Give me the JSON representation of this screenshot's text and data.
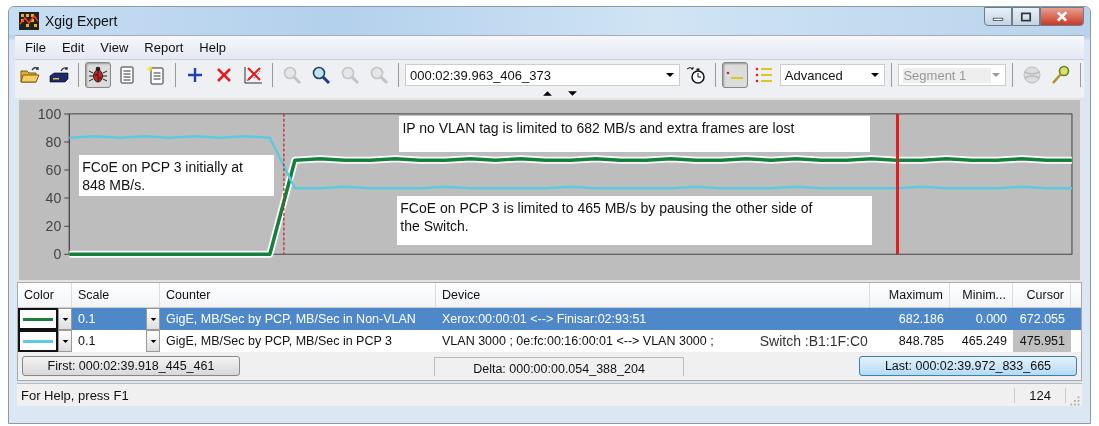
{
  "window": {
    "title": "Xgig Expert"
  },
  "menu": [
    "File",
    "Edit",
    "View",
    "Report",
    "Help"
  ],
  "toolbar": {
    "left_tools": [
      {
        "pressed": false,
        "disabled": false
      },
      {
        "pressed": false,
        "disabled": false
      },
      {
        "pressed": true,
        "disabled": false
      },
      {
        "pressed": false,
        "disabled": false
      },
      {
        "pressed": false,
        "disabled": false
      },
      {
        "pressed": false,
        "disabled": false
      },
      {
        "pressed": false,
        "disabled": false
      },
      {
        "pressed": false,
        "disabled": false
      },
      {
        "pressed": false,
        "disabled": true
      },
      {
        "pressed": false,
        "disabled": false
      },
      {
        "pressed": false,
        "disabled": true
      },
      {
        "pressed": false,
        "disabled": true
      }
    ],
    "time_combo": {
      "value": "000:02:39.963_406_373"
    },
    "mid_tools": [
      {
        "pressed": false,
        "disabled": false
      },
      {
        "pressed": true,
        "disabled": false
      },
      {
        "pressed": false,
        "disabled": false
      }
    ],
    "mode_combo": {
      "value": "Advanced",
      "disabled": false
    },
    "segment_combo": {
      "value": "Segment 1",
      "disabled": true
    },
    "right_tools": [
      {
        "pressed": false,
        "disabled": true
      },
      {
        "pressed": false,
        "disabled": false
      }
    ]
  },
  "chart": {
    "notes": [
      "FCoE on PCP 3 initially at 848 MB/s.",
      "IP no VLAN tag is limited to 682 MB/s and extra frames are lost",
      "FCoE on PCP 3 is limited to 465 MB/s by pausing the other side of the Switch."
    ],
    "chart_data": {
      "type": "line",
      "ylim": [
        0,
        100
      ],
      "yticks": [
        0,
        20,
        40,
        60,
        80,
        100
      ],
      "series": [
        {
          "color": "#14803c",
          "values": [
            0,
            0,
            0,
            0,
            0,
            0,
            0,
            0,
            0,
            67,
            68,
            67,
            67,
            68,
            67,
            67,
            68,
            67,
            68,
            67,
            67,
            68,
            67,
            67,
            68,
            67,
            67,
            68,
            67,
            68,
            67,
            67,
            68,
            67,
            67,
            68,
            67,
            67,
            68,
            67,
            67
          ]
        },
        {
          "color": "#5ccbe0",
          "values": [
            83,
            84,
            83,
            84,
            83,
            84,
            83,
            84,
            83,
            47,
            47,
            48,
            47,
            47,
            47,
            48,
            47,
            47,
            47,
            47,
            48,
            47,
            47,
            47,
            47,
            48,
            47,
            47,
            47,
            48,
            47,
            47,
            47,
            47,
            48,
            47,
            47,
            47,
            48,
            47,
            47
          ]
        }
      ]
    }
  },
  "table": {
    "columns": [
      "Color",
      "Scale",
      "Counter",
      "Device",
      "Maximum",
      "Minim...",
      "Cursor"
    ],
    "rows": [
      {
        "selected": true,
        "color": "#14803c",
        "scale": "0.1",
        "counter": "GigE, MB/Sec by PCP, MB/Sec in Non-VLAN",
        "device": "Xerox:00:00:01 <--> Finisar:02:93:51",
        "maximum": "682.186",
        "minimum": "0.000",
        "cursor": "672.055",
        "cursor_highlighted": false
      },
      {
        "selected": false,
        "color": "#5ccbe0",
        "scale": "0.1",
        "counter": "GigE, MB/Sec by PCP, MB/Sec in PCP 3",
        "device": "VLAN 3000 ; 0e:fc:00:16:00:01 <--> VLAN 3000 ;",
        "device_note": "Switch :B1:1F:C0",
        "maximum": "848.785",
        "minimum": "465.249",
        "cursor": "475.951",
        "cursor_highlighted": true
      }
    ]
  },
  "range": {
    "first": {
      "label": "First: 000:02:39.918_445_461",
      "selected": false
    },
    "delta": "Delta: 000:00:00.054_388_204",
    "last": {
      "label": "Last: 000:02:39.972_833_665",
      "selected": true
    }
  },
  "status_bar": {
    "text": "For Help, press F1",
    "count": "124"
  }
}
